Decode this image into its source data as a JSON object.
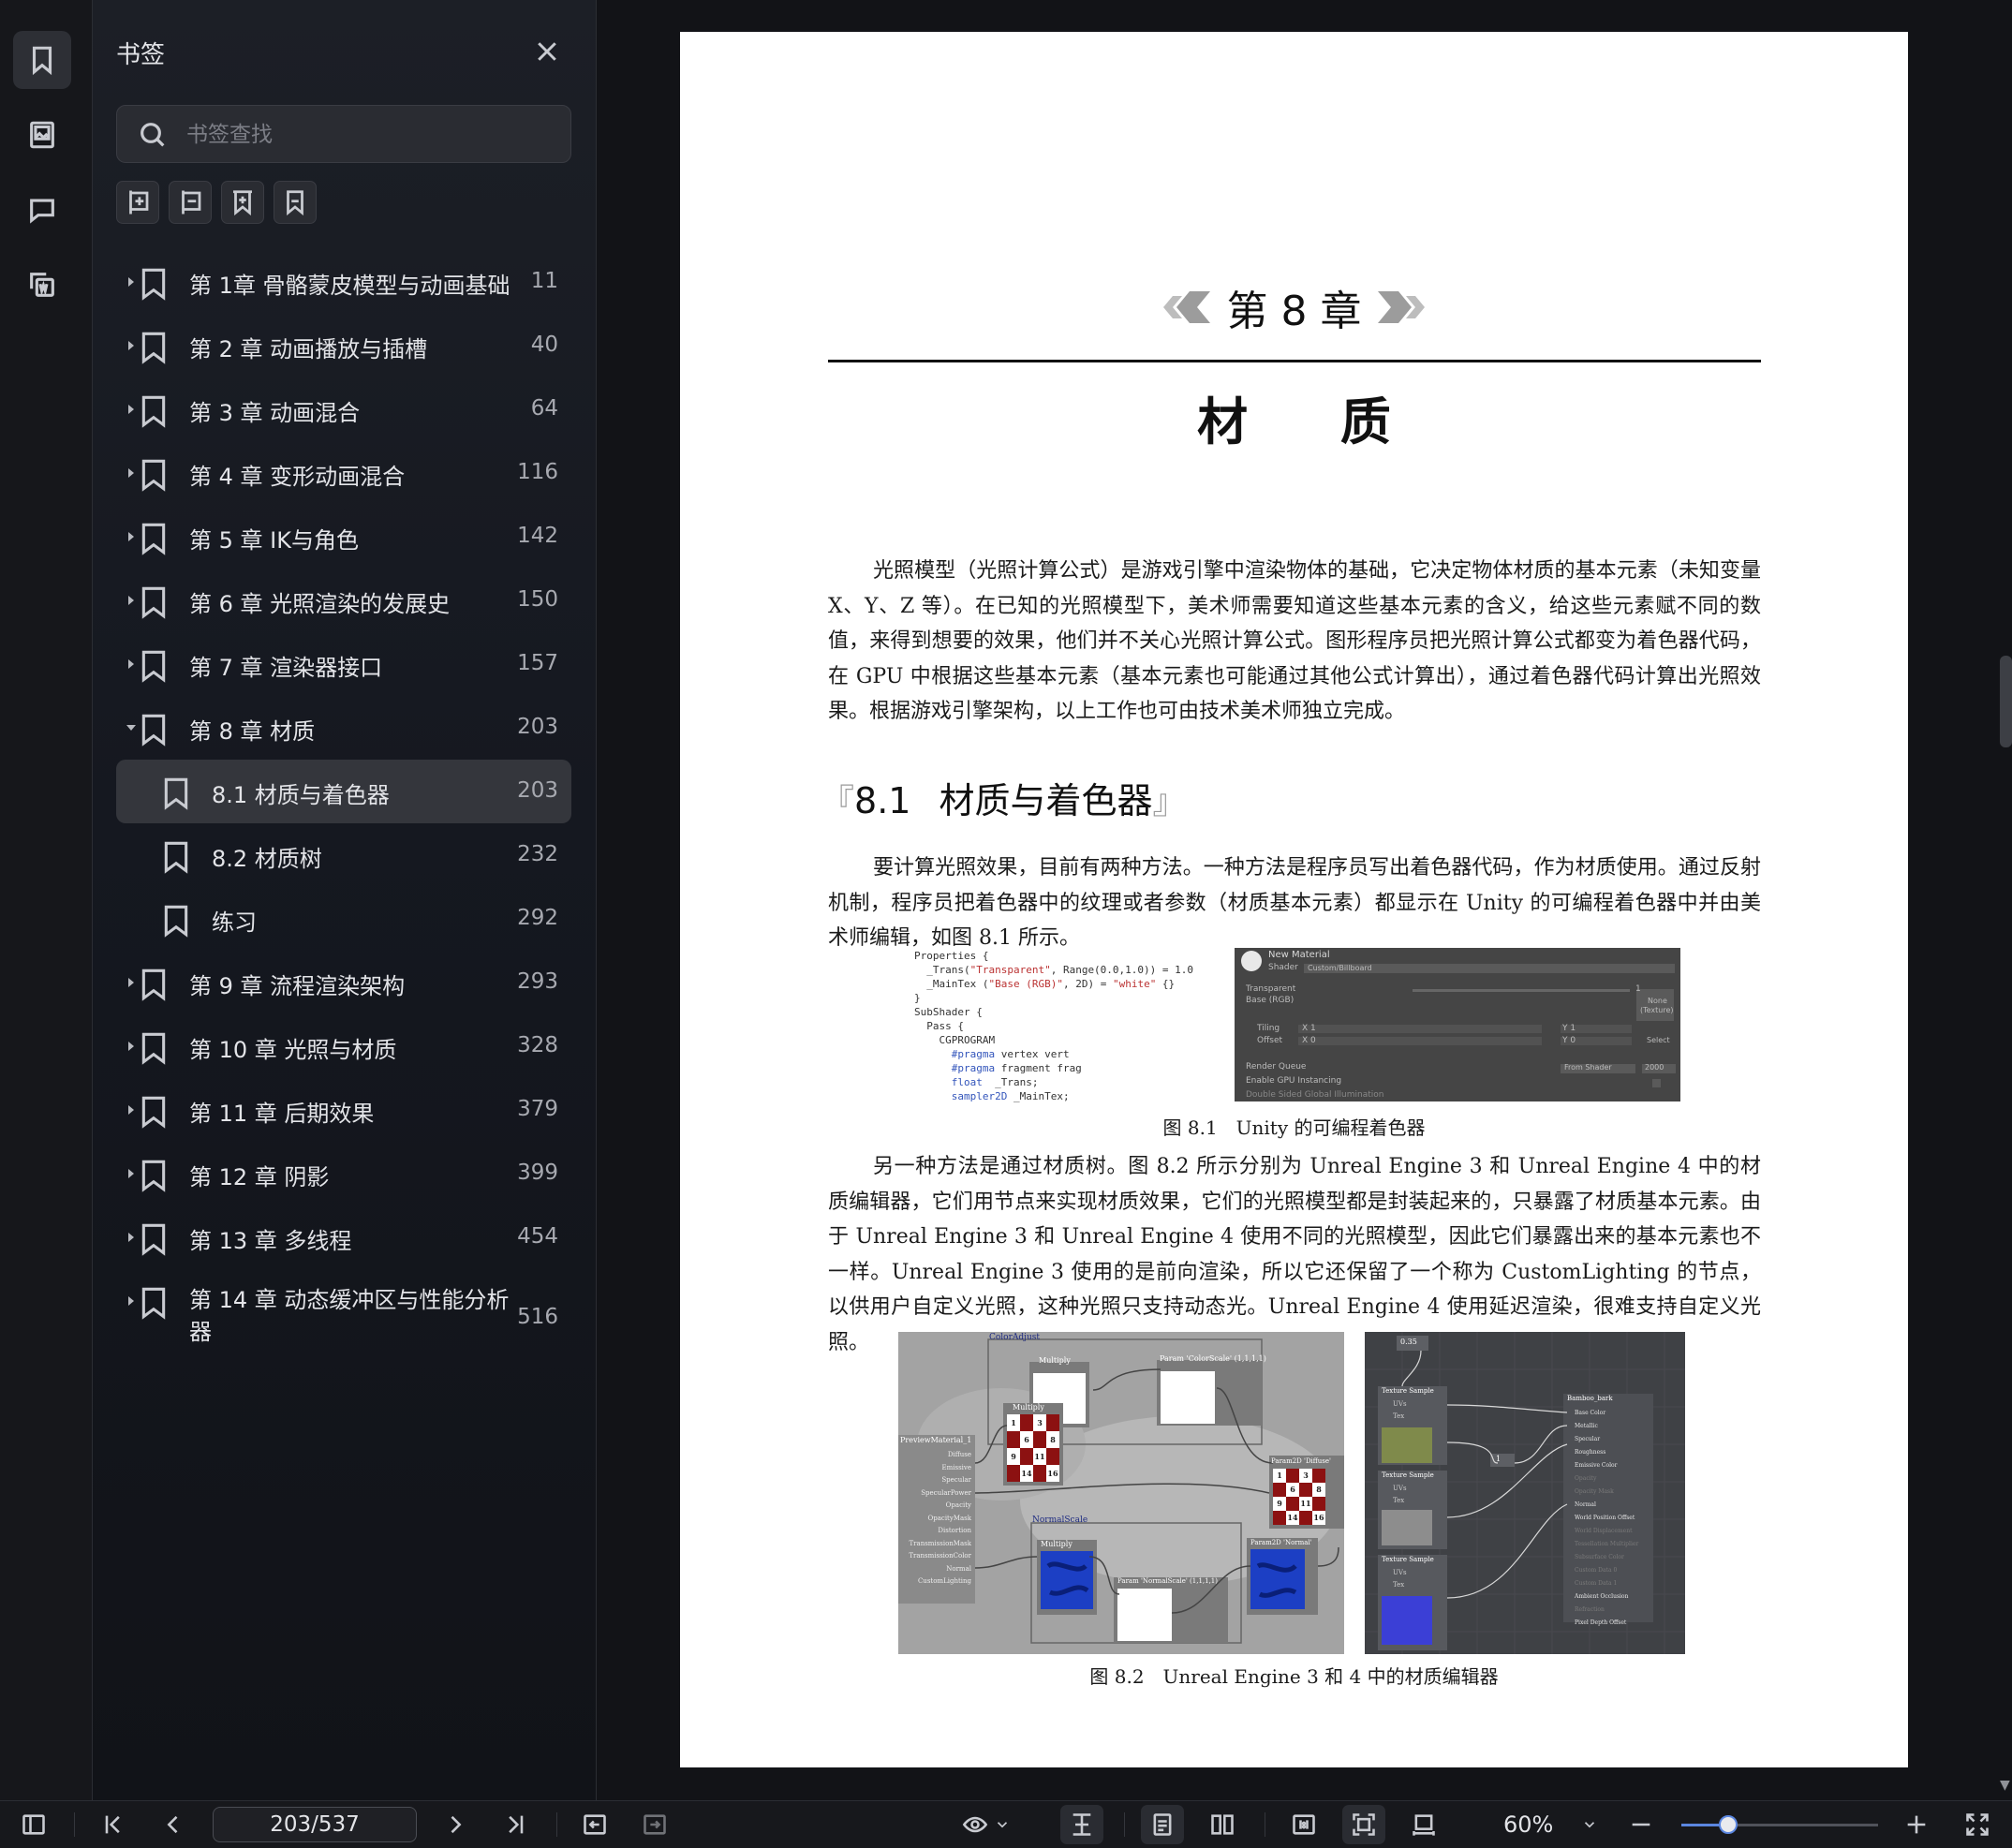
{
  "sidebar": {
    "title": "书签",
    "search_placeholder": "书签查找",
    "rail_icons": [
      "bookmark-icon",
      "image-icon",
      "comment-icon",
      "ocr-icon"
    ],
    "tool_icons": [
      "expand-all-icon",
      "collapse-all-icon",
      "add-bookmark-icon",
      "bookmark-current-icon"
    ],
    "bookmarks": [
      {
        "label": "第 1章 骨骼蒙皮模型与动画基础",
        "page": "11"
      },
      {
        "label": "第 2 章 动画播放与插槽",
        "page": "40"
      },
      {
        "label": "第 3 章 动画混合",
        "page": "64"
      },
      {
        "label": "第 4 章 变形动画混合",
        "page": "116"
      },
      {
        "label": "第 5 章 IK与角色",
        "page": "142"
      },
      {
        "label": "第 6 章 光照渲染的发展史",
        "page": "150"
      },
      {
        "label": "第 7 章 渲染器接口",
        "page": "157"
      },
      {
        "label": "第 8 章 材质",
        "page": "203"
      },
      {
        "label": "8.1 材质与着色器",
        "page": "203"
      },
      {
        "label": "8.2 材质树",
        "page": "232"
      },
      {
        "label": "练习",
        "page": "292"
      },
      {
        "label": "第 9 章 流程渲染架构",
        "page": "293"
      },
      {
        "label": "第 10 章 光照与材质",
        "page": "328"
      },
      {
        "label": "第 11 章 后期效果",
        "page": "379"
      },
      {
        "label": "第 12 章 阴影",
        "page": "399"
      },
      {
        "label": "第 13 章 多线程",
        "page": "454"
      },
      {
        "label": "第 14 章 动态缓冲区与性能分析器",
        "page": "516"
      }
    ]
  },
  "document": {
    "chapter_number": "第 8 章",
    "chapter_title": "材 质",
    "intro": "光照模型（光照计算公式）是游戏引擎中渲染物体的基础，它决定物体材质的基本元素（未知变量 X、Y、Z 等）。在已知的光照模型下，美术师需要知道这些基本元素的含义，给这些元素赋不同的数值，来得到想要的效果，他们并不关心光照计算公式。图形程序员把光照计算公式都变为着色器代码，在 GPU 中根据这些基本元素（基本元素也可能通过其他公式计算出），通过着色器代码计算出光照效果。根据游戏引擎架构，以上工作也可由技术美术师独立完成。",
    "section_number": "8.1",
    "section_title": "材质与着色器",
    "para2": "要计算光照效果，目前有两种方法。一种方法是程序员写出着色器代码，作为材质使用。通过反射机制，程序员把着色器中的纹理或者参数（材质基本元素）都显示在 Unity 的可编程着色器中并由美术师编辑，如图 8.1 所示。",
    "fig1_caption": "图 8.1　Unity 的可编程着色器",
    "para3": "另一种方法是通过材质树。图 8.2 所示分别为 Unreal Engine 3 和 Unreal Engine 4 中的材质编辑器，它们用节点来实现材质效果，它们的光照模型都是封装起来的，只暴露了材质基本元素。由于 Unreal Engine 3 和 Unreal Engine 4 使用不同的光照模型，因此它们暴露出来的基本元素也不一样。Unreal Engine 3 使用的是前向渲染，所以它还保留了一个称为 CustomLighting 的节点，以供用户自定义光照，这种光照只支持动态光。Unreal Engine 4 使用延迟渲染，很难支持自定义光照。",
    "fig2_caption": "图 8.2　Unreal Engine 3 和 4 中的材质编辑器",
    "fig1_code": {
      "line1": "Properties {",
      "line2a": "  _Trans(",
      "line2s": "\"Transparent\"",
      "line2b": ", Range(0.0,1.0)) = 1.0",
      "line3a": "  _MainTex (",
      "line3s": "\"Base (RGB)\"",
      "line3b": ", 2D) = ",
      "line3t": "\"white\"",
      "line3c": " {}",
      "line4": "}",
      "line5": "SubShader {",
      "line6": "  Pass {",
      "line7": "    CGPROGRAM",
      "line8k": "      #pragma",
      "line8": " vertex vert",
      "line9k": "      #pragma",
      "line9": " fragment frag",
      "line10k": "      float",
      "line10": "  _Trans;",
      "line11k": "      sampler2D",
      "line11": " _MainTex;"
    },
    "fig1_inspector": {
      "name": "New Material",
      "shader_label": "Shader",
      "shader_value": "Custom/Billboard",
      "transparent": "Transparent",
      "transparent_value": "1",
      "base": "Base (RGB)",
      "tex_none": "None",
      "tex_type": "(Texture)",
      "tiling": "Tiling",
      "offset": "Offset",
      "x1": "X 1",
      "y1": "Y 1",
      "x0": "X 0",
      "y0": "Y 0",
      "select": "Select",
      "render_queue": "Render Queue",
      "from_shader": "From Shader",
      "queue_value": "2000",
      "gpu_instancing": "Enable GPU Instancing",
      "double_sided": "Double Sided Global Illumination"
    },
    "fig2_ue3": {
      "color_adjust": "ColorAdjust",
      "multiply": "Multiply",
      "param_color": "Param 'ColorScale' (1,1,1,1)",
      "preview": "PreviewMaterial_1",
      "inputs": [
        "Diffuse",
        "Emissive",
        "Specular",
        "SpecularPower",
        "Opacity",
        "OpacityMask",
        "Distortion",
        "TransmissionMask",
        "TransmissionColor",
        "Normal",
        "CustomLighting"
      ],
      "normal_scale": "NormalScale",
      "param_normal": "Param 'NormalScale' (1,1,1,1)",
      "tex_diffuse": "Param2D 'Diffuse'",
      "tex_normal": "Param2D 'Normal'",
      "checker": [
        "1",
        "3",
        "6",
        "8",
        "9",
        "11",
        "14",
        "16"
      ]
    },
    "fig2_ue4": {
      "const": "0.35",
      "tex_sample": "Texture Sample",
      "uvs": "UVs",
      "tex": "Tex",
      "one": "1",
      "node": "Bamboo_bark",
      "pins": [
        "Base Color",
        "Metallic",
        "Specular",
        "Roughness",
        "Emissive Color",
        "Opacity",
        "Opacity Mask",
        "Normal",
        "World Position Offset",
        "World Displacement",
        "Tessellation Multiplier",
        "Subsurface Color",
        "Custom Data 0",
        "Custom Data 1",
        "Ambient Occlusion",
        "Refraction",
        "Pixel Depth Offset"
      ]
    }
  },
  "statusbar": {
    "page_indicator": "203/537",
    "zoom": "60%",
    "zoom_fraction": 0.24
  }
}
